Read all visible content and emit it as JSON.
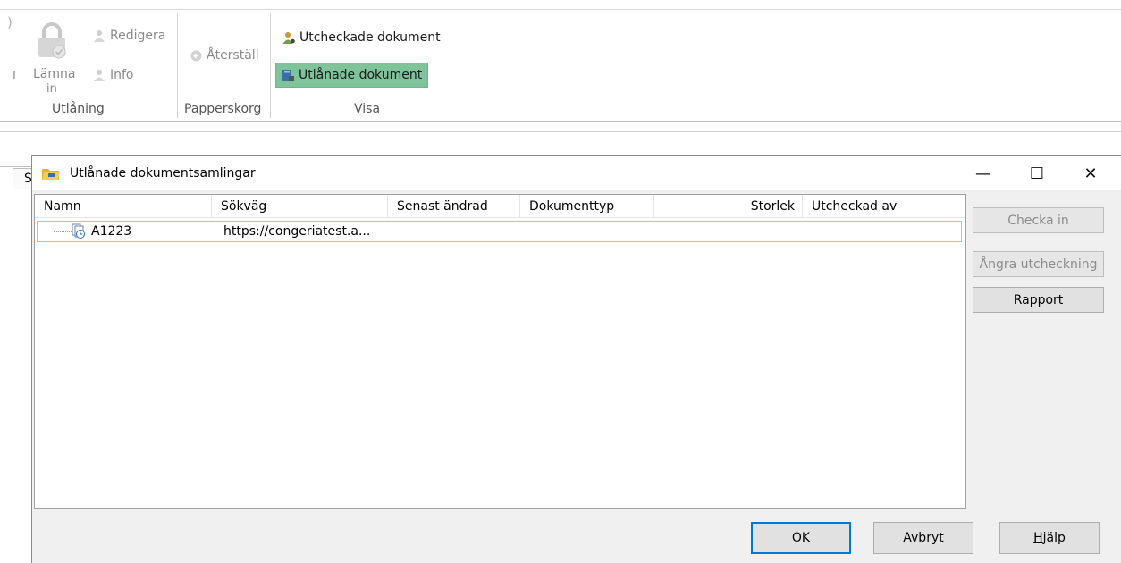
{
  "ribbon": {
    "lock_partial": ")",
    "partial_label": "ı",
    "redigera": "Redigera",
    "lamna_line1": "Lämna",
    "lamna_line2": "in",
    "info": "Info",
    "aterstall": "Återställ",
    "utcheckade": "Utcheckade dokument",
    "utlanade": "Utlånade dokument",
    "groups": {
      "utlaning": "Utlåning",
      "papperskorg": "Papperskorg",
      "visa": "Visa"
    }
  },
  "background_tab_char": "S",
  "dialog": {
    "title": "Utlånade dokumentsamlingar",
    "minimize": "—",
    "maximize": "☐",
    "close": "✕",
    "columns": [
      "Namn",
      "Sökväg",
      "Senast ändrad",
      "Dokumenttyp",
      "Storlek",
      "Utcheckad av"
    ],
    "rows": [
      {
        "name": "A1223",
        "path": "https://congeriatest.a...",
        "modified": "",
        "doctype": "",
        "size": "",
        "checked_out_by": ""
      }
    ],
    "side_buttons": {
      "checka_in": "Checka in",
      "angra": "Ångra utcheckning",
      "rapport": "Rapport"
    },
    "bottom_buttons": {
      "ok": "OK",
      "avbryt": "Avbryt",
      "hjalp": "Hjälp"
    }
  },
  "colors": {
    "selected_ribbon": "#7fc39a",
    "row_border": "#99c9ef",
    "default_button_border": "#0078d7"
  }
}
